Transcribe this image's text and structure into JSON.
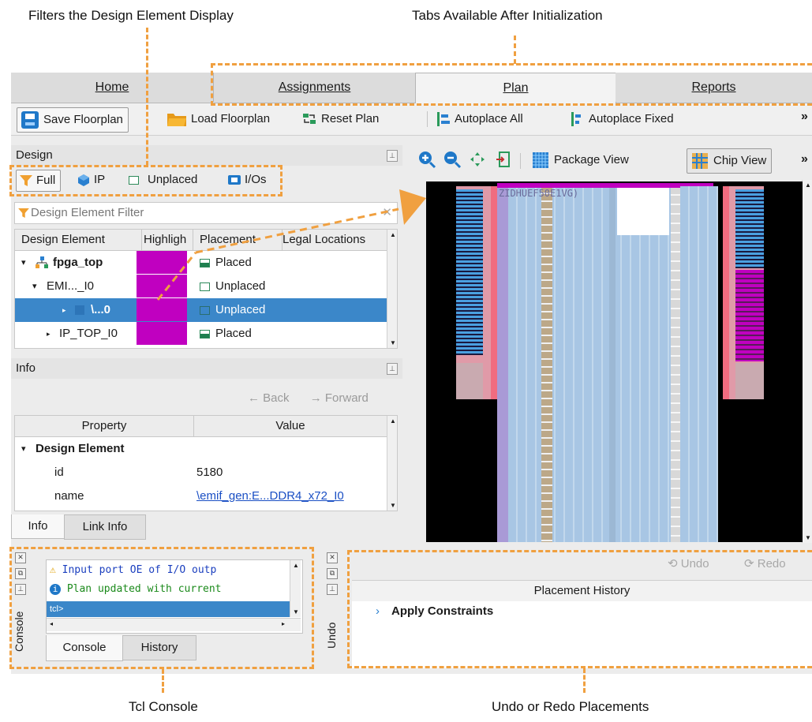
{
  "callouts": {
    "filters": "Filters the Design Element Display",
    "tabs": "Tabs Available After Initialization",
    "tcl": "Tcl Console",
    "undo": "Undo or Redo Placements"
  },
  "tabs": [
    {
      "label": "Home",
      "active": false
    },
    {
      "label": "Assignments",
      "active": false
    },
    {
      "label": "Plan",
      "active": true
    },
    {
      "label": "Reports",
      "active": false
    }
  ],
  "toolbar": {
    "save": "Save Floorplan",
    "load": "Load Floorplan",
    "reset": "Reset Plan",
    "autoplace_all": "Autoplace All",
    "autoplace_fixed": "Autoplace Fixed",
    "more": "»"
  },
  "design": {
    "title": "Design",
    "filters": [
      "Full",
      "IP",
      "Unplaced",
      "I/Os"
    ],
    "filter_placeholder": "Design Element Filter",
    "columns": [
      "Design Element",
      "Highligh",
      "Placement",
      "Legal Locations"
    ],
    "rows": [
      {
        "name": "fpga_top",
        "placement": "Placed",
        "bold": true,
        "selected": false
      },
      {
        "name": "EMI..._I0",
        "placement": "Unplaced",
        "bold": false,
        "selected": false
      },
      {
        "name": "\\...0",
        "placement": "Unplaced",
        "bold": true,
        "selected": true
      },
      {
        "name": "IP_TOP_I0",
        "placement": "Placed",
        "bold": false,
        "selected": false
      }
    ],
    "highlight_color": "#c000c0"
  },
  "info": {
    "title": "Info",
    "back": "Back",
    "forward": "Forward",
    "columns": [
      "Property",
      "Value"
    ],
    "group": "Design Element",
    "props": [
      {
        "key": "id",
        "value": "5180"
      },
      {
        "key": "name",
        "value": "\\emif_gen:E...DDR4_x72_I0"
      }
    ],
    "tabs": [
      "Info",
      "Link Info"
    ]
  },
  "view": {
    "package": "Package View",
    "chip": "Chip View",
    "more": "»",
    "chip_label": "ZIDHUEF50E1VG)"
  },
  "console": {
    "side_label": "Console",
    "messages": [
      {
        "kind": "warning",
        "text": "Input port OE of I/O outp"
      },
      {
        "kind": "info",
        "text": "Plan updated with current"
      }
    ],
    "prompt": "tcl>",
    "tabs": [
      "Console",
      "History"
    ]
  },
  "undo": {
    "side_label": "Undo",
    "undo": "Undo",
    "redo": "Redo",
    "history_title": "Placement History",
    "items": [
      "Apply Constraints"
    ]
  }
}
